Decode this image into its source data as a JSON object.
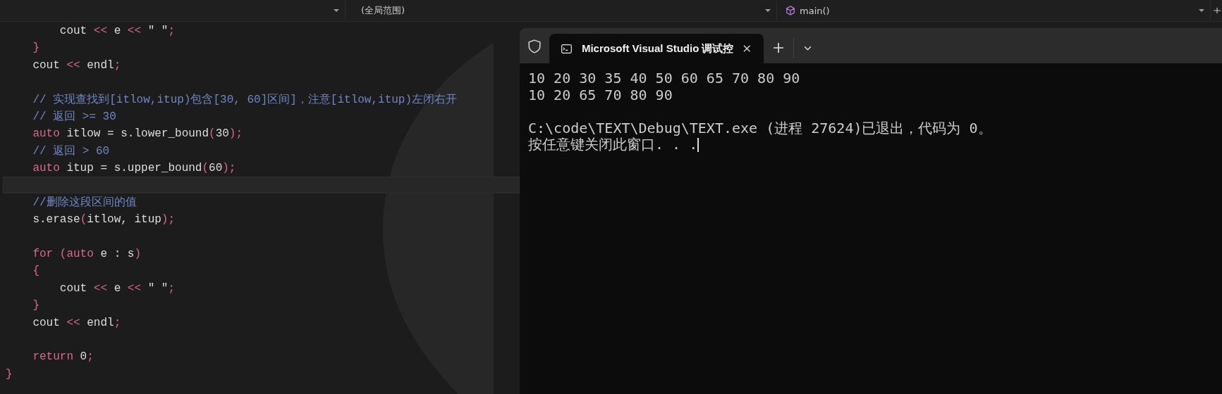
{
  "navigation_bar": {
    "dropdowns": [
      {
        "kind": "blank"
      },
      {
        "text": "(全局范围)",
        "kind": "text"
      },
      {
        "text": "main()",
        "kind": "function"
      }
    ]
  },
  "editor": {
    "lines": [
      {
        "current": false,
        "segments": [
          {
            "text": "        cout ",
            "kind": "plain"
          },
          {
            "text": "<<",
            "kind": "kw"
          },
          {
            "text": " e ",
            "kind": "plain"
          },
          {
            "text": "<<",
            "kind": "kw"
          },
          {
            "text": " \" \"",
            "kind": "plain"
          },
          {
            "text": ";",
            "kind": "kw"
          }
        ]
      },
      {
        "current": false,
        "segments": [
          {
            "text": "    }",
            "kind": "kw"
          }
        ]
      },
      {
        "current": false,
        "segments": [
          {
            "text": "    cout ",
            "kind": "plain"
          },
          {
            "text": "<<",
            "kind": "kw"
          },
          {
            "text": " endl",
            "kind": "plain"
          },
          {
            "text": ";",
            "kind": "kw"
          }
        ]
      },
      {
        "current": false
      },
      {
        "current": false,
        "segments": [
          {
            "text": "    // 实现查找到[itlow,itup)包含[30, 60]区间]，注意[itlow,itup)左闭右开",
            "kind": "comment"
          }
        ]
      },
      {
        "current": false,
        "segments": [
          {
            "text": "    // 返回 >= 30",
            "kind": "comment"
          }
        ]
      },
      {
        "current": false,
        "segments": [
          {
            "text": "    auto",
            "kind": "kw"
          },
          {
            "text": " itlow = s.lower_bound",
            "kind": "plain"
          },
          {
            "text": "(",
            "kind": "kw"
          },
          {
            "text": "30",
            "kind": "plain"
          },
          {
            "text": ");",
            "kind": "kw"
          }
        ]
      },
      {
        "current": false,
        "segments": [
          {
            "text": "    // 返回 > 60",
            "kind": "comment"
          }
        ]
      },
      {
        "current": false,
        "segments": [
          {
            "text": "    auto",
            "kind": "kw"
          },
          {
            "text": " itup = s.upper_bound",
            "kind": "plain"
          },
          {
            "text": "(",
            "kind": "kw"
          },
          {
            "text": "60",
            "kind": "plain"
          },
          {
            "text": ");",
            "kind": "kw"
          }
        ]
      },
      {
        "current": true
      },
      {
        "current": false,
        "segments": [
          {
            "text": "    //删除这段区间的值",
            "kind": "comment"
          }
        ]
      },
      {
        "current": false,
        "segments": [
          {
            "text": "    s.erase",
            "kind": "plain"
          },
          {
            "text": "(",
            "kind": "kw"
          },
          {
            "text": "itlow, itup",
            "kind": "plain"
          },
          {
            "text": ");",
            "kind": "kw"
          }
        ]
      },
      {
        "current": false
      },
      {
        "current": false,
        "segments": [
          {
            "text": "    for (auto",
            "kind": "kw"
          },
          {
            "text": " e : s",
            "kind": "plain"
          },
          {
            "text": ")",
            "kind": "kw"
          }
        ]
      },
      {
        "current": false,
        "segments": [
          {
            "text": "    {",
            "kind": "kw"
          }
        ]
      },
      {
        "current": false,
        "segments": [
          {
            "text": "        cout ",
            "kind": "plain"
          },
          {
            "text": "<<",
            "kind": "kw"
          },
          {
            "text": " e ",
            "kind": "plain"
          },
          {
            "text": "<<",
            "kind": "kw"
          },
          {
            "text": " \" \"",
            "kind": "plain"
          },
          {
            "text": ";",
            "kind": "kw"
          }
        ]
      },
      {
        "current": false,
        "segments": [
          {
            "text": "    }",
            "kind": "kw"
          }
        ]
      },
      {
        "current": false,
        "segments": [
          {
            "text": "    cout ",
            "kind": "plain"
          },
          {
            "text": "<<",
            "kind": "kw"
          },
          {
            "text": " endl",
            "kind": "plain"
          },
          {
            "text": ";",
            "kind": "kw"
          }
        ]
      },
      {
        "current": false
      },
      {
        "current": false,
        "segments": [
          {
            "text": "    return",
            "kind": "kw"
          },
          {
            "text": " 0",
            "kind": "plain"
          },
          {
            "text": ";",
            "kind": "kw"
          }
        ]
      },
      {
        "current": false,
        "segments": [
          {
            "text": "}",
            "kind": "kw"
          }
        ]
      }
    ]
  },
  "terminal": {
    "tab": {
      "title": "Microsoft Visual Studio 调试控",
      "selected": true
    },
    "output_blocks": [
      [
        "10 20 30 35 40 50 60 65 70 80 90",
        "10 20 65 70 80 90"
      ],
      [
        "C:\\code\\TEXT\\Debug\\TEXT.exe (进程 27624)已退出，代码为 0。",
        "按任意键关闭此窗口. . ."
      ]
    ]
  }
}
